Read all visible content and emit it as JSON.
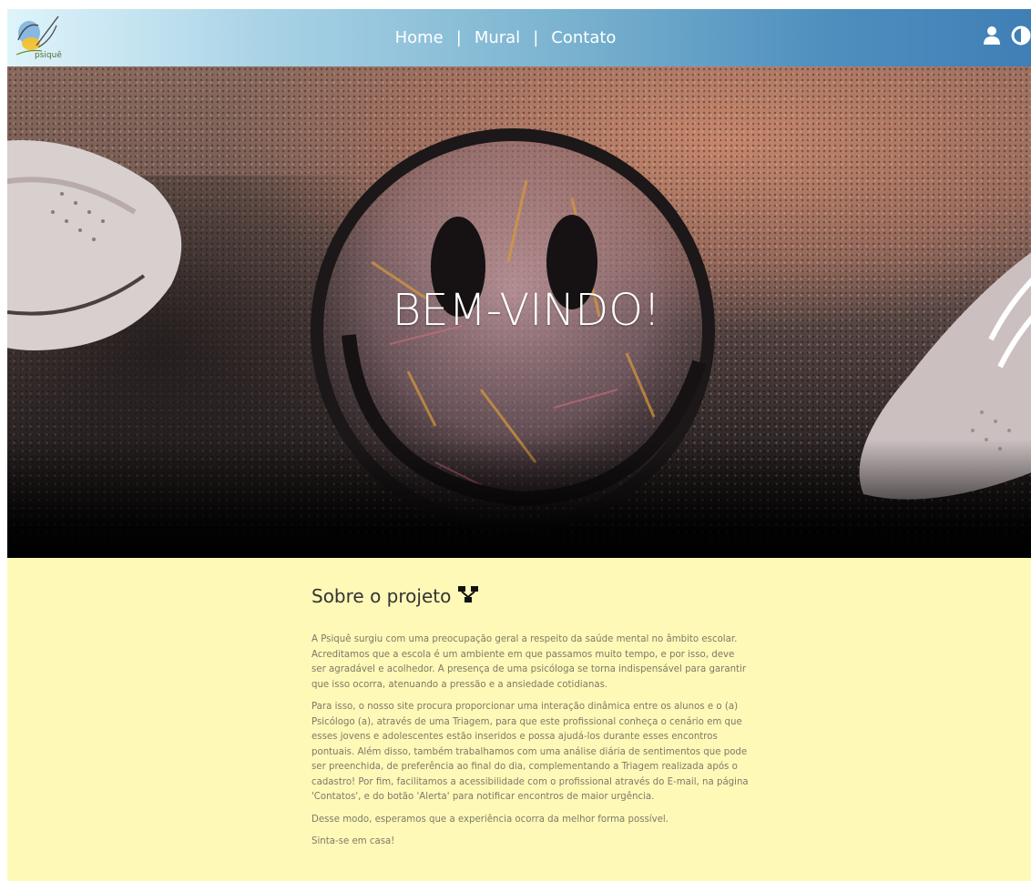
{
  "navbar": {
    "logo_text": "psiquê",
    "links": [
      "Home",
      "Mural",
      "Contato"
    ],
    "separator": "|",
    "icons": [
      "user-icon",
      "contrast-icon"
    ]
  },
  "hero": {
    "title": "BEM-VINDO!"
  },
  "about": {
    "title": "Sobre o projeto",
    "title_icon": "sitemap-icon",
    "paragraphs": [
      "A Psiquê surgiu com uma preocupação geral a respeito da saúde mental no âmbito escolar. Acreditamos que a escola é um ambiente em que passamos muito tempo, e por isso, deve ser agradável e acolhedor. A presença de uma psicóloga se torna indispensável para garantir que isso ocorra, atenuando a pressão e a ansiedade cotidianas.",
      "Para isso, o nosso site procura proporcionar uma interação dinâmica entre os alunos e o (a) Psicólogo (a), através de uma Triagem, para que este profissional conheça o cenário em que esses jovens e adolescentes estão inseridos e possa ajudá-los durante esses encontros pontuais. Além disso, também trabalhamos com uma análise diária de sentimentos que pode ser preenchida, de preferência ao final do dia, complementando a Triagem realizada após o cadastro! Por fim, facilitamos a acessibilidade com o profissional através do E-mail, na página 'Contatos', e do botão 'Alerta' para notificar encontros de maior urgência.",
      "Desse modo, esperamos que a experiência ocorra da melhor forma possível.",
      "Sinta-se em casa!"
    ]
  },
  "colors": {
    "navbar_start": "#dff4fb",
    "navbar_end": "#3f7fb6",
    "about_bg": "#fff9b8",
    "text_muted": "#7d7966"
  }
}
